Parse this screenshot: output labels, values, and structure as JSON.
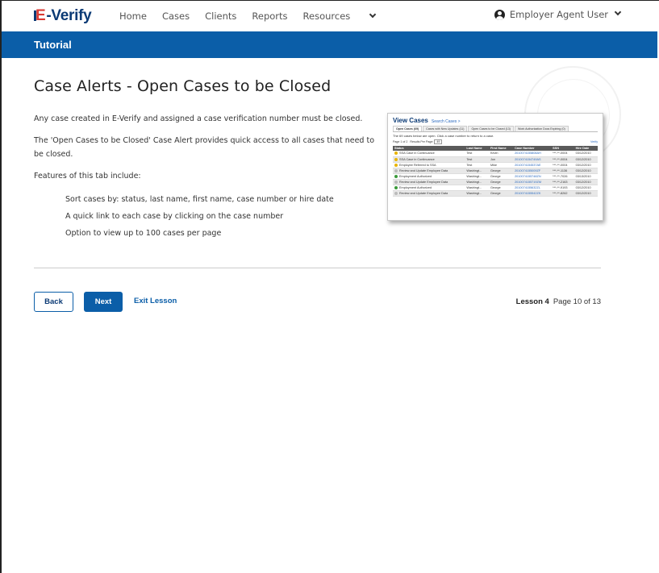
{
  "nav": {
    "logo_e": "E",
    "logo_rest": "-Verify",
    "links": [
      "Home",
      "Cases",
      "Clients",
      "Reports",
      "Resources"
    ],
    "user": "Employer Agent User"
  },
  "banner": {
    "title": "Tutorial"
  },
  "content": {
    "heading": "Case Alerts - Open Cases to be Closed",
    "para1": "Any case created in E-Verify and assigned a case verification number must be closed.",
    "para2": "The 'Open Cases to be Closed' Case Alert provides quick access to all cases that need to be closed.",
    "para3": "Features of this tab include:",
    "features": [
      "Sort cases by: status, last name, first name, case number or hire date",
      "A quick link to each case by clicking on the case number",
      "Option to view up to 100 cases per page"
    ]
  },
  "thumbnail": {
    "title": "View Cases",
    "search_link": "Search Cases >",
    "tabs": [
      "Open Cases (69)",
      "Cases with New Updates (11)",
      "Open Cases to be Closed (13)",
      "Work Authorization Docs Expiring (0)"
    ],
    "info": "The 69 cases below are open. Click a case number to return to a case.",
    "page_label": "Page 1 of 2",
    "results_label": "Results Per Page:",
    "results_value": "49",
    "verify_link": "Verify",
    "headers": [
      "Status",
      "Last Name",
      "First Name",
      "Case Number",
      "SSN",
      "Hire Date"
    ],
    "rows": [
      {
        "status": "SSA Case in Continuance",
        "last": "Test",
        "first": "Kevin",
        "case": "2010074155808AH",
        "ssn": "***-**-0004",
        "hire": "03/12/2010",
        "color": "#e8b400"
      },
      {
        "status": "SSA Case in Continuance",
        "last": "Test",
        "first": "Jon",
        "case": "2010074154749AS",
        "ssn": "***-**-0004",
        "hire": "03/12/2010",
        "color": "#e8b400"
      },
      {
        "status": "Employee Referred to SSA",
        "last": "Test",
        "first": "Mike",
        "case": "2010074154537AE",
        "ssn": "***-**-0004",
        "hire": "03/12/2010",
        "color": "#e8b400"
      },
      {
        "status": "Review and Update Employee Data",
        "last": "Washingt...",
        "first": "George",
        "case": "2010074155009ZF",
        "ssn": "***-**-1136",
        "hire": "03/12/2010",
        "color": "#bbbbbb"
      },
      {
        "status": "Employment Authorized",
        "last": "Washingt...",
        "first": "George",
        "case": "2010074155748ZN",
        "ssn": "***-**-7026",
        "hire": "03/13/2010",
        "color": "#3a9a3a"
      },
      {
        "status": "Review and Update Employee Data",
        "last": "Washingt...",
        "first": "George",
        "case": "2010074155719ZM",
        "ssn": "***-**-2163",
        "hire": "03/12/2010",
        "color": "#bbbbbb"
      },
      {
        "status": "Employment Authorized",
        "last": "Washingt...",
        "first": "George",
        "case": "2010074155632ZL",
        "ssn": "***-**-9193",
        "hire": "03/12/2010",
        "color": "#3a9a3a"
      },
      {
        "status": "Review and Update Employee Data",
        "last": "Washingt...",
        "first": "George",
        "case": "2010074155542ZK",
        "ssn": "***-**-8262",
        "hire": "03/12/2010",
        "color": "#bbbbbb"
      }
    ]
  },
  "footer": {
    "back": "Back",
    "next": "Next",
    "exit": "Exit Lesson",
    "lesson": "Lesson 4",
    "page": "Page 10 of 13"
  },
  "colors": {
    "brand": "#0b5ea8",
    "logo_red": "#d83933",
    "logo_navy": "#0b3a75"
  }
}
